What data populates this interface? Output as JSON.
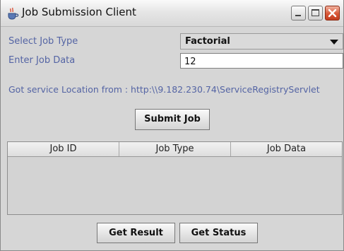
{
  "window": {
    "title": "Job Submission Client",
    "icon": "java-cup-icon"
  },
  "form": {
    "job_type_label": "Select Job Type",
    "job_type_selected": "Factorial",
    "job_data_label": "Enter Job Data",
    "job_data_value": "12"
  },
  "service": {
    "status_text": "Got service Location from : http:\\\\9.182.230.74\\ServiceRegistryServlet"
  },
  "buttons": {
    "submit_label": "Submit Job",
    "get_result_label": "Get Result",
    "get_status_label": "Get Status"
  },
  "table": {
    "columns": [
      "Job ID",
      "Job Type",
      "Job Data"
    ],
    "rows": []
  },
  "colors": {
    "label_text": "#5464a4",
    "window_bg": "#d6d6d6",
    "close_button": "#d85737"
  }
}
